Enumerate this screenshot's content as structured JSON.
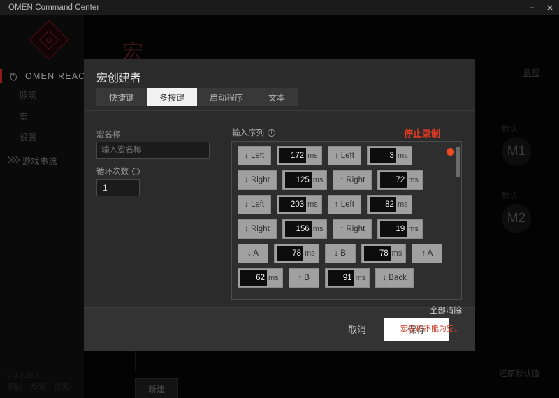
{
  "window": {
    "title": "OMEN Command Center",
    "minimize_label": "–",
    "close_label": "✕"
  },
  "sidebar": {
    "device_label": "OMEN REACTOR",
    "device_icon": "mouse-icon",
    "nav_items": [
      {
        "label": "照明"
      },
      {
        "label": "宏"
      },
      {
        "label": "设置"
      }
    ],
    "stream": {
      "icon": "stream-icon",
      "label": "游戏串流"
    }
  },
  "content": {
    "page_title": "宏",
    "tutorial_link": "教程",
    "profiles": [
      {
        "caption": "默认",
        "name": "M1"
      },
      {
        "caption": "默认",
        "name": "M2"
      }
    ],
    "new_button": "新建",
    "restore_defaults": "还原默认值",
    "version": "v. 4.0.29.0",
    "footer_links": [
      "帮助",
      "反馈",
      "隐私"
    ]
  },
  "dialog": {
    "title": "宏创建者",
    "tabs": [
      {
        "label": "快捷键",
        "active": false
      },
      {
        "label": "多按键",
        "active": true
      },
      {
        "label": "启动程序",
        "active": false
      },
      {
        "label": "文本",
        "active": false
      }
    ],
    "macro_name": {
      "label": "宏名称",
      "placeholder": "输入宏名称",
      "value": ""
    },
    "loop_count": {
      "label": "循环次数",
      "info_icon": "info-icon",
      "value": "1"
    },
    "sequence": {
      "label": "输入序列",
      "info_icon": "info-icon",
      "stop_record": "停止录制",
      "recording_indicator": "record-dot",
      "record_color": "#f04a21",
      "clear_all": "全部清除",
      "unit": "ms",
      "items": [
        {
          "type": "key",
          "label": "↓ Left"
        },
        {
          "type": "delay",
          "value": "172"
        },
        {
          "type": "key",
          "label": "↑ Left"
        },
        {
          "type": "delay",
          "value": "3"
        },
        {
          "type": "key",
          "label": "↓ Right"
        },
        {
          "type": "delay",
          "value": "125"
        },
        {
          "type": "key",
          "label": "↑ Right"
        },
        {
          "type": "delay",
          "value": "72"
        },
        {
          "type": "key",
          "label": "↓ Left"
        },
        {
          "type": "delay",
          "value": "203"
        },
        {
          "type": "key",
          "label": "↑ Left"
        },
        {
          "type": "delay",
          "value": "82"
        },
        {
          "type": "key",
          "label": "↓ Right"
        },
        {
          "type": "delay",
          "value": "156"
        },
        {
          "type": "key",
          "label": "↑ Right"
        },
        {
          "type": "delay",
          "value": "19"
        },
        {
          "type": "key",
          "label": "↓ A"
        },
        {
          "type": "delay",
          "value": "78"
        },
        {
          "type": "key",
          "label": "↓ B"
        },
        {
          "type": "delay",
          "value": "78"
        },
        {
          "type": "key",
          "label": "↑ A"
        },
        {
          "type": "delay",
          "value": "62"
        },
        {
          "type": "key",
          "label": "↑ B"
        },
        {
          "type": "delay",
          "value": "91"
        },
        {
          "type": "key",
          "label": "↓ Back"
        }
      ]
    },
    "error_message": "宏名称不能为空。",
    "cancel_label": "取消",
    "save_label": "保存"
  }
}
